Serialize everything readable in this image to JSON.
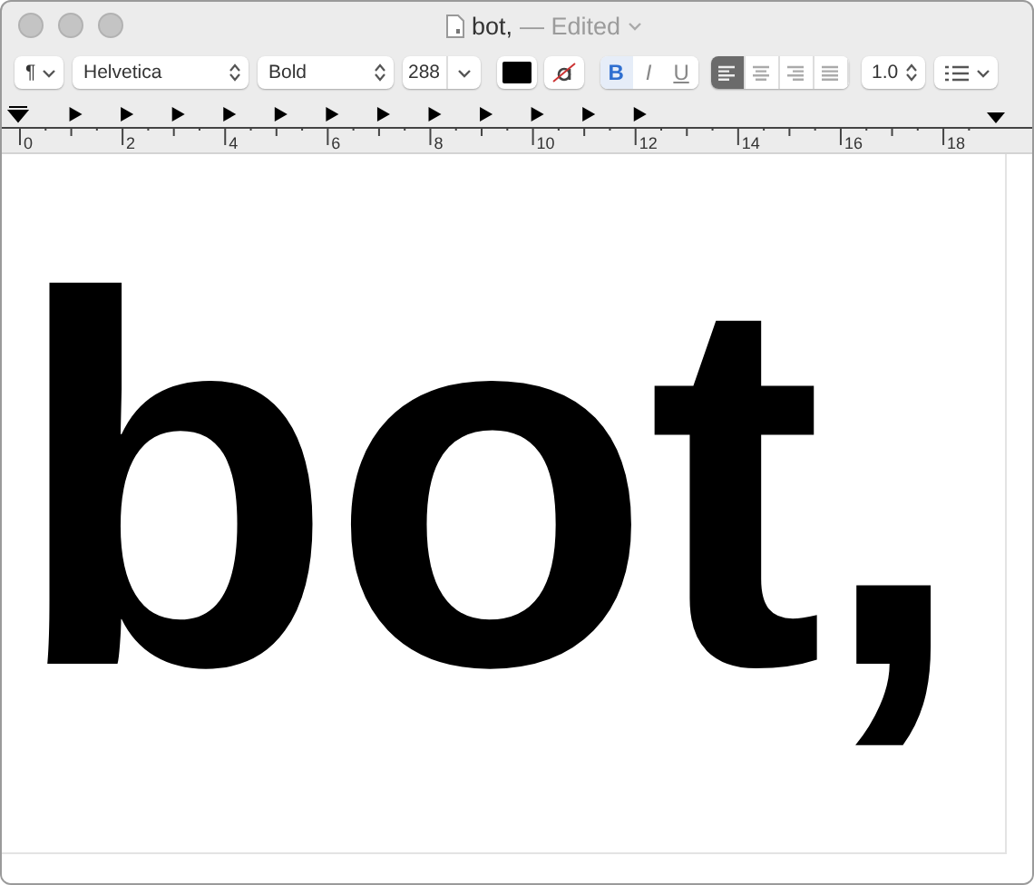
{
  "window": {
    "title": "bot,",
    "status": "— Edited"
  },
  "toolbar": {
    "paragraph_style": "¶",
    "font": "Helvetica",
    "typeface": "Bold",
    "size": "288",
    "styles": [
      {
        "kind": "bold",
        "label": "B",
        "selected": true
      },
      {
        "kind": "italic",
        "label": "I",
        "selected": false
      },
      {
        "kind": "underline",
        "label": "U",
        "selected": false
      }
    ],
    "alignment": [
      {
        "kind": "left",
        "selected": true
      },
      {
        "kind": "center",
        "selected": false
      },
      {
        "kind": "right",
        "selected": false
      },
      {
        "kind": "justify",
        "selected": false
      }
    ],
    "line_spacing": "1.0"
  },
  "ruler": {
    "numbers": [
      "0",
      "2",
      "4",
      "6",
      "8",
      "10",
      "12",
      "14",
      "16",
      "18"
    ]
  },
  "document": {
    "text": "bot,"
  }
}
